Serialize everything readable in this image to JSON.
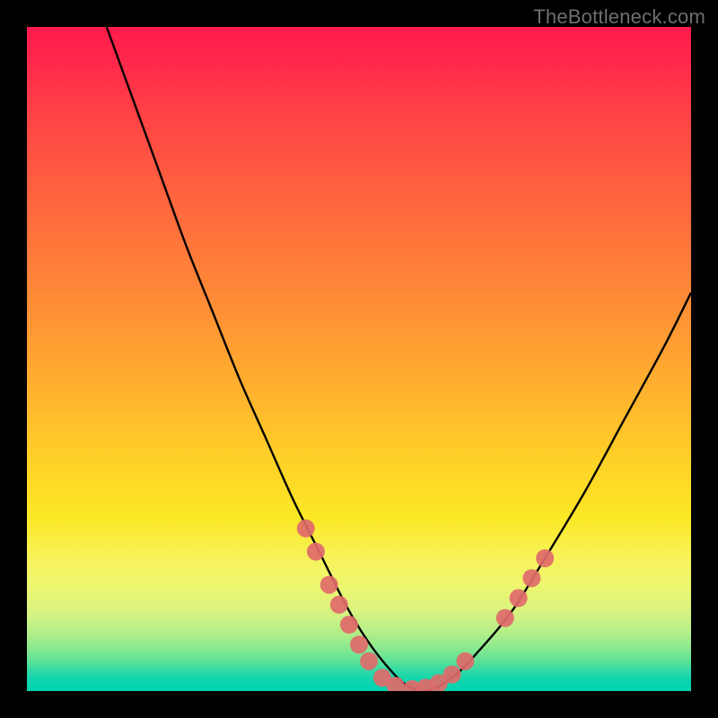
{
  "watermark": "TheBottleneck.com",
  "chart_data": {
    "type": "line",
    "title": "",
    "xlabel": "",
    "ylabel": "",
    "xlim": [
      0,
      100
    ],
    "ylim": [
      0,
      100
    ],
    "grid": false,
    "legend": false,
    "series": [
      {
        "name": "curve",
        "color": "#000000",
        "x": [
          12,
          16,
          20,
          24,
          28,
          32,
          36,
          40,
          44,
          48,
          51,
          54,
          57,
          60,
          64,
          68,
          73,
          78,
          84,
          90,
          96,
          100
        ],
        "y": [
          100,
          89,
          78,
          67,
          57,
          47,
          38,
          29,
          21,
          13,
          8,
          4,
          1,
          0,
          2,
          6,
          12,
          20,
          30,
          41,
          52,
          60
        ]
      }
    ],
    "markers": [
      {
        "x": 42.0,
        "y": 24.5,
        "color": "#e06a6a"
      },
      {
        "x": 43.5,
        "y": 21.0,
        "color": "#e06a6a"
      },
      {
        "x": 45.5,
        "y": 16.0,
        "color": "#e06a6a"
      },
      {
        "x": 47.0,
        "y": 13.0,
        "color": "#e06a6a"
      },
      {
        "x": 48.5,
        "y": 10.0,
        "color": "#e06a6a"
      },
      {
        "x": 50.0,
        "y": 7.0,
        "color": "#e06a6a"
      },
      {
        "x": 51.5,
        "y": 4.5,
        "color": "#e06a6a"
      },
      {
        "x": 53.5,
        "y": 2.0,
        "color": "#e06a6a"
      },
      {
        "x": 55.5,
        "y": 0.8,
        "color": "#e06a6a"
      },
      {
        "x": 58.0,
        "y": 0.3,
        "color": "#e06a6a"
      },
      {
        "x": 60.0,
        "y": 0.5,
        "color": "#e06a6a"
      },
      {
        "x": 62.0,
        "y": 1.2,
        "color": "#e06a6a"
      },
      {
        "x": 64.0,
        "y": 2.5,
        "color": "#e06a6a"
      },
      {
        "x": 66.0,
        "y": 4.5,
        "color": "#e06a6a"
      },
      {
        "x": 72.0,
        "y": 11.0,
        "color": "#e06a6a"
      },
      {
        "x": 74.0,
        "y": 14.0,
        "color": "#e06a6a"
      },
      {
        "x": 76.0,
        "y": 17.0,
        "color": "#e06a6a"
      },
      {
        "x": 78.0,
        "y": 20.0,
        "color": "#e06a6a"
      }
    ],
    "background_gradient": {
      "direction": "vertical",
      "stops": [
        {
          "pos": 0.0,
          "color": "#ff1a4d"
        },
        {
          "pos": 0.5,
          "color": "#ffb22e"
        },
        {
          "pos": 0.8,
          "color": "#f7f35a"
        },
        {
          "pos": 1.0,
          "color": "#00d3b0"
        }
      ]
    }
  }
}
